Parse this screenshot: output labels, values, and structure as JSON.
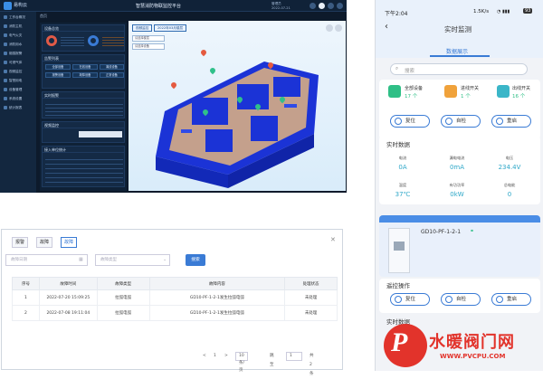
{
  "desktop": {
    "brand": "易构云",
    "title": "智慧消防物联监控平台",
    "user_meta": [
      "管理员",
      "2022-07-21"
    ],
    "sidebar": [
      "工作台概况",
      "消防主机",
      "电气火灾",
      "消防用水",
      "烟感报警",
      "可燃气体",
      "视频监控",
      "智慧用电",
      "设备管理",
      "系统设置",
      "统计报表"
    ],
    "breadcrumb": "首页",
    "panel": {
      "card1_title": "设备总览",
      "card2_title": "告警列表",
      "card3_title": "实时报警",
      "card4_title": "视频监控",
      "card5_title": "接入单位统计",
      "status_buttons": [
        "全部设备",
        "在线设备",
        "离线设备",
        "报警设备",
        "故障设备",
        "正常设备"
      ]
    },
    "scene_tabs": [
      "视频监控",
      "2022年03月楼层"
    ],
    "scene_select": [
      "请选择楼层",
      "请选择设备"
    ]
  },
  "dialog": {
    "tabs": [
      "报警",
      "故障",
      "故障"
    ],
    "date_placeholder": "故障日期",
    "type_placeholder": "故障类型",
    "search_label": "搜索",
    "columns": [
      "序号",
      "故障时间",
      "故障类型",
      "故障内容",
      "处理状态"
    ],
    "rows": [
      [
        "1",
        "2022-07-20 15:09:25",
        "拉弧电弧",
        "GD10-PF-1-2-1发生拉弧电弧",
        "未处理"
      ],
      [
        "2",
        "2022-07-08 19:11:04",
        "拉弧电弧",
        "GD10-PF-1-2-1发生拉弧电弧",
        "未处理"
      ]
    ],
    "pager": {
      "prev": "<",
      "page": "1",
      "next": ">",
      "size": "10 条/页",
      "goto": "跳至",
      "goto_val": "1",
      "total": "共 2 条"
    }
  },
  "phone": {
    "time": "下午2:04",
    "status": "1.5K/s",
    "battery": "93",
    "title": "实时监测",
    "subtitle": "数据展示",
    "search_placeholder": "搜索",
    "stats": [
      {
        "label": "全部设备",
        "value": "17 个",
        "color": "#2fbf86"
      },
      {
        "label": "进线开关",
        "value": "1 个",
        "color": "#f0a23b"
      },
      {
        "label": "出线开关",
        "value": "16 个",
        "color": "#3bb6c8"
      }
    ],
    "actions": [
      "复位",
      "自检",
      "重启"
    ],
    "section_title": "实时数据",
    "metrics": [
      {
        "k": "电流",
        "v": "0A"
      },
      {
        "k": "漏电电流",
        "v": "0mA"
      },
      {
        "k": "电压",
        "v": "234.4V"
      },
      {
        "k": "温度",
        "v": "37℃"
      },
      {
        "k": "有功功率",
        "v": "0kW"
      },
      {
        "k": "总电能",
        "v": "0"
      }
    ],
    "device_name": "GD10-PF-1-2-1",
    "remote_title": "遥控操作",
    "actions2": [
      "复位",
      "自检",
      "重启"
    ],
    "section_title2": "实时数据"
  },
  "watermark": {
    "brand": "水暖阀门网",
    "url": "WWW.PVCPU.COM"
  },
  "colors": {
    "accent": "#3a7bd5",
    "phone_header": "#e9f1fb",
    "watermark_red": "#e2332b"
  }
}
